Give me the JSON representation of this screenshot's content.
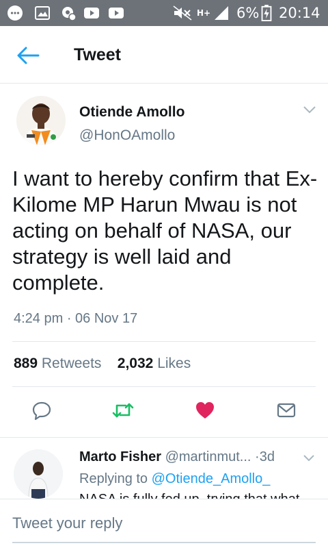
{
  "status_bar": {
    "left_icons": [
      "messenger-icon",
      "gallery-icon",
      "settings-notification-icon",
      "youtube-icon",
      "youtube-icon"
    ],
    "right_icons": [
      "mute-icon",
      "hplus-network-icon",
      "signal-icon",
      "battery-charging-icon"
    ],
    "network": "H+",
    "battery": "6%",
    "time": "20:14"
  },
  "app_bar": {
    "title": "Tweet"
  },
  "tweet": {
    "author_name": "Otiende Amollo",
    "author_handle": "@HonOAmollo",
    "text": "I want to hereby confirm that Ex-Kilome MP Harun Mwau is not acting on behalf of NASA, our strategy is well laid and complete.",
    "timestamp": "4:24 pm · 06 Nov 17",
    "retweets_count": "889",
    "retweets_label": "Retweets",
    "likes_count": "2,032",
    "likes_label": "Likes",
    "liked": true
  },
  "actions": [
    "reply-icon",
    "retweet-icon",
    "like-heart-icon",
    "direct-message-icon"
  ],
  "reply": {
    "author_name": "Marto Fisher",
    "author_handle": "@martinmut...",
    "separator": "·",
    "age": "3d",
    "replying_label": "Replying to",
    "replying_to": "@Otiende_Amollo_",
    "text": "NASA is fully fed up, trying that what"
  },
  "composer": {
    "placeholder": "Tweet your reply"
  },
  "colors": {
    "accent": "#1da1f2",
    "retweet_green": "#17bf63",
    "like_red": "#e0245e",
    "secondary_text": "#657786",
    "status_bar": "#6d7279"
  }
}
